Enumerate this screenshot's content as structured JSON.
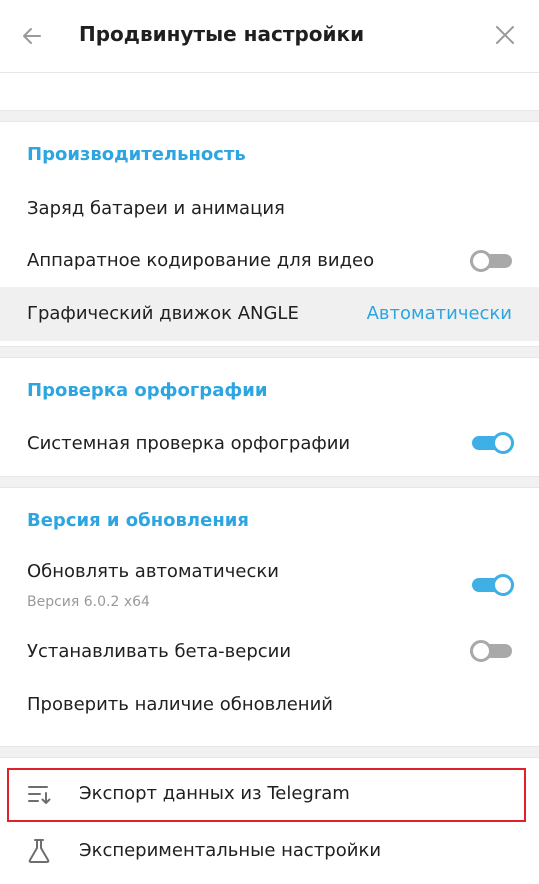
{
  "header": {
    "title": "Продвинутые настройки",
    "back_icon": "arrow-left-icon",
    "close_icon": "close-icon"
  },
  "performance": {
    "section_title": "Производительность",
    "battery_label": "Заряд батареи и анимация",
    "hw_encoding_label": "Аппаратное кодирование для видео",
    "hw_encoding_enabled": false,
    "angle_label": "Графический движок ANGLE",
    "angle_value": "Автоматически"
  },
  "spellcheck": {
    "section_title": "Проверка орфографии",
    "system_spellcheck_label": "Системная проверка орфографии",
    "system_spellcheck_enabled": true
  },
  "updates": {
    "section_title": "Версия и обновления",
    "auto_update_label": "Обновлять автоматически",
    "version_text": "Версия 6.0.2 x64",
    "auto_update_enabled": true,
    "beta_label": "Устанавливать бета-версии",
    "beta_enabled": false,
    "check_updates_label": "Проверить наличие обновлений"
  },
  "footer_items": {
    "export_label": "Экспорт данных из Telegram",
    "export_icon": "export-list-icon",
    "experimental_label": "Экспериментальные настройки",
    "experimental_icon": "flask-icon"
  },
  "colors": {
    "accent": "#2ca5e0",
    "highlight_border": "#e0202a"
  }
}
